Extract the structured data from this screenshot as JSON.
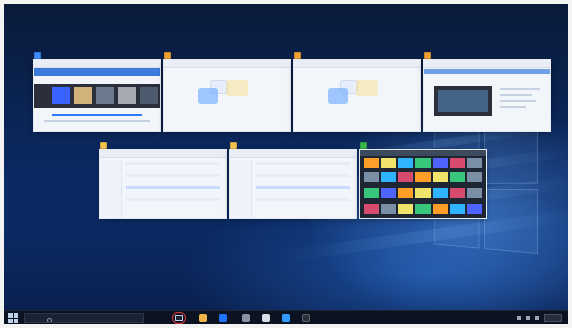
{
  "task_view": {
    "windows": [
      {
        "id": "w1",
        "title": "",
        "app_icon": "chrome-icon"
      },
      {
        "id": "w2",
        "title": "",
        "app_icon": "chrome-icon"
      },
      {
        "id": "w3",
        "title": "",
        "app_icon": "chrome-icon"
      },
      {
        "id": "w4",
        "title": "",
        "app_icon": "chrome-icon"
      },
      {
        "id": "w5",
        "title": "",
        "app_icon": "file-explorer-icon"
      },
      {
        "id": "w6",
        "title": "",
        "app_icon": "file-explorer-icon"
      },
      {
        "id": "w7",
        "title": "",
        "app_icon": "photos-icon"
      }
    ]
  },
  "taskbar": {
    "search_placeholder": "",
    "start_icon": "windows-start-icon",
    "task_view_icon": "task-view-icon",
    "pinned_icons": [
      "folder-icon",
      "browser-icon",
      "store-icon",
      "files-icon",
      "mail-icon",
      "search-icon"
    ],
    "highlight_color": "#e03a3a"
  },
  "watermark": {
    "line1": "",
    "line2": ""
  }
}
